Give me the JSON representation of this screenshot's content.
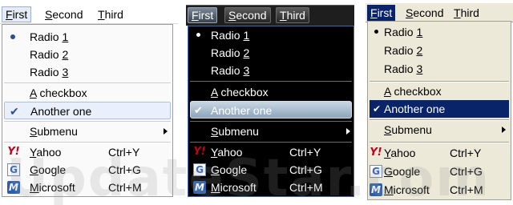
{
  "menubar": {
    "items": [
      {
        "label": "First",
        "mnemonic": "F",
        "rest": "irst"
      },
      {
        "label": "Second",
        "mnemonic": "S",
        "rest": "econd"
      },
      {
        "label": "Third",
        "mnemonic": "T",
        "rest": "hird"
      }
    ]
  },
  "menu": {
    "radios": [
      {
        "label": "Radio 1",
        "pre": "Radio ",
        "mnemonic": "1",
        "checked": true
      },
      {
        "label": "Radio 2",
        "pre": "Radio ",
        "mnemonic": "2",
        "checked": false
      },
      {
        "label": "Radio 3",
        "pre": "Radio ",
        "mnemonic": "3",
        "checked": false
      }
    ],
    "checkboxes": [
      {
        "label": "A checkbox",
        "pre": "",
        "mnemonic": "A",
        "rest": " checkbox",
        "checked": false
      },
      {
        "label": "Another one",
        "checked": true
      }
    ],
    "submenu": {
      "label": "Submenu",
      "pre": "",
      "mnemonic": "S",
      "rest": "ubmenu"
    },
    "links": [
      {
        "label": "Yahoo",
        "mnemonic": "Y",
        "rest": "ahoo",
        "shortcut": "Ctrl+Y",
        "icon": "yahoo-icon",
        "glyph": "Y!"
      },
      {
        "label": "Google",
        "mnemonic": "G",
        "rest": "oogle",
        "shortcut": "Ctrl+G",
        "icon": "google-icon",
        "glyph": "G"
      },
      {
        "label": "Microsoft",
        "mnemonic": "M",
        "rest": "icrosoft",
        "shortcut": "Ctrl+M",
        "icon": "microsoft-icon",
        "glyph": "M"
      }
    ]
  },
  "themes": [
    {
      "name": "luna",
      "accent": "#a9c1e6"
    },
    {
      "name": "dark",
      "accent": "#8ea4b9"
    },
    {
      "name": "classic",
      "accent": "#0a246a"
    }
  ],
  "watermark": "UpdateStar.com"
}
